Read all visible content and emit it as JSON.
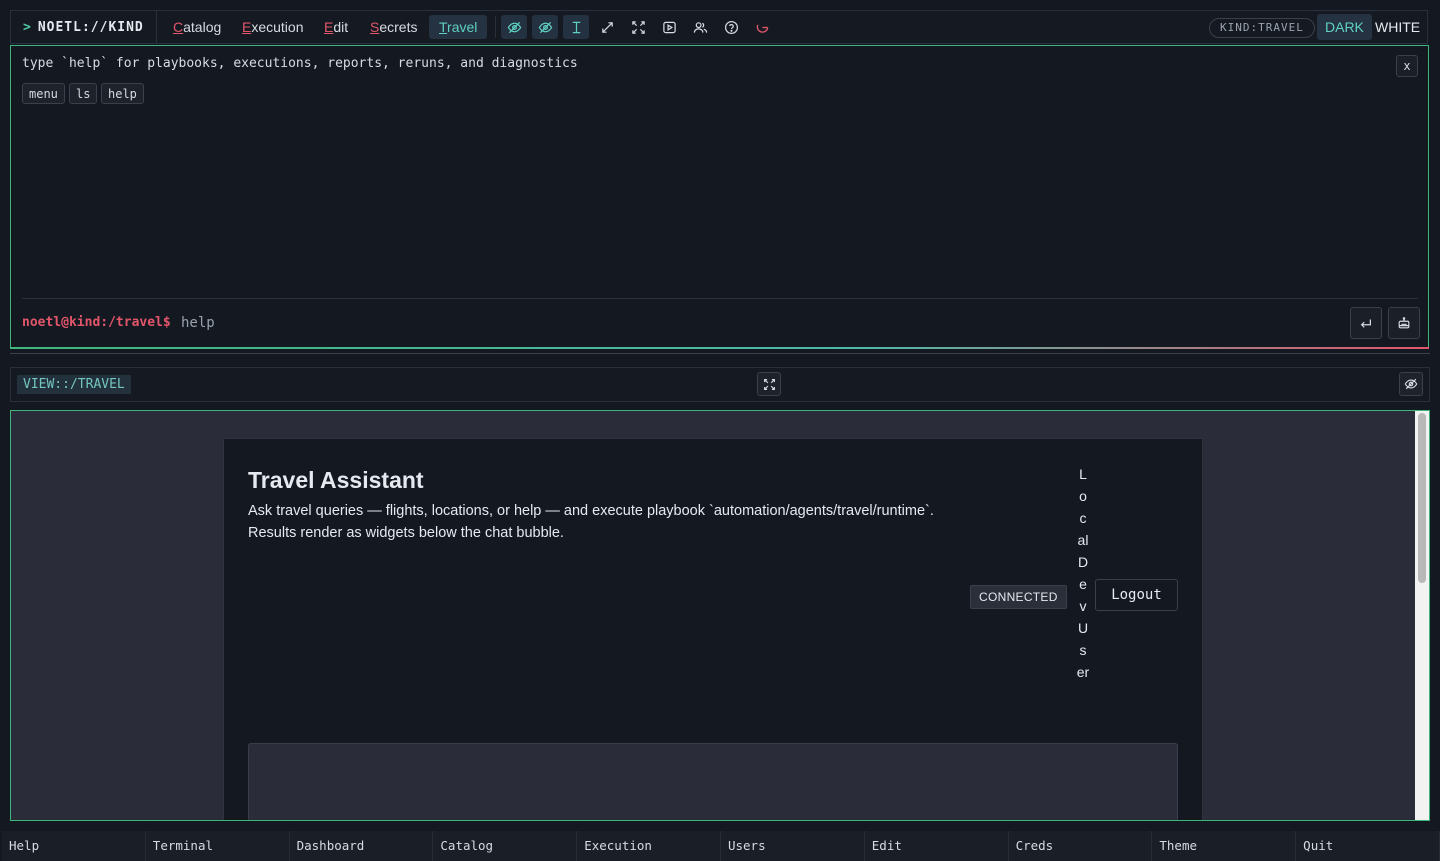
{
  "topbar": {
    "brand_prompt": ">",
    "brand": "NOETL://KIND",
    "menus": [
      {
        "accel": "C",
        "rest": "atalog"
      },
      {
        "accel": "E",
        "rest": "xecution"
      },
      {
        "accel": "E",
        "rest": "dit"
      },
      {
        "accel": "S",
        "rest": "ecrets"
      },
      {
        "accel": "T",
        "rest": "ravel"
      }
    ],
    "active_menu": "Travel",
    "tools": [
      "eye-off-icon",
      "eye-off-icon",
      "text-cursor-icon",
      "expand-diagonal-icon",
      "fullscreen-icon",
      "play-icon",
      "users-icon",
      "help-icon",
      "refresh-icon"
    ],
    "kind_badge": "KIND:TRAVEL",
    "theme_dark": "DARK",
    "theme_white": "WHITE",
    "active_theme": "DARK"
  },
  "terminal": {
    "hint": "type `help` for playbooks, executions, reports, reruns, and diagnostics",
    "close_label": "x",
    "chips": [
      "menu",
      "ls",
      "help"
    ],
    "prompt": "noetl@kind:/travel$",
    "input_value": "help",
    "submit_icon": "enter-icon",
    "assist_icon": "robot-icon"
  },
  "view": {
    "label": "VIEW::/TRAVEL",
    "fit_icon": "fullscreen-icon",
    "hide_icon": "eye-off-icon"
  },
  "app": {
    "title": "Travel Assistant",
    "description": "Ask travel queries — flights, locations, or help — and execute playbook `automation/agents/travel/runtime`. Results render as widgets below the chat bubble.",
    "status": "CONNECTED",
    "user": "LocalDevUser",
    "logout": "Logout"
  },
  "fkeys": [
    "Help",
    "Terminal",
    "Dashboard",
    "Catalog",
    "Execution",
    "Users",
    "Edit",
    "Creds",
    "Theme",
    "Quit"
  ],
  "colors": {
    "accent": "#5fd0c3",
    "success": "#3fb57c",
    "danger": "#e2566b",
    "background": "#141821"
  }
}
